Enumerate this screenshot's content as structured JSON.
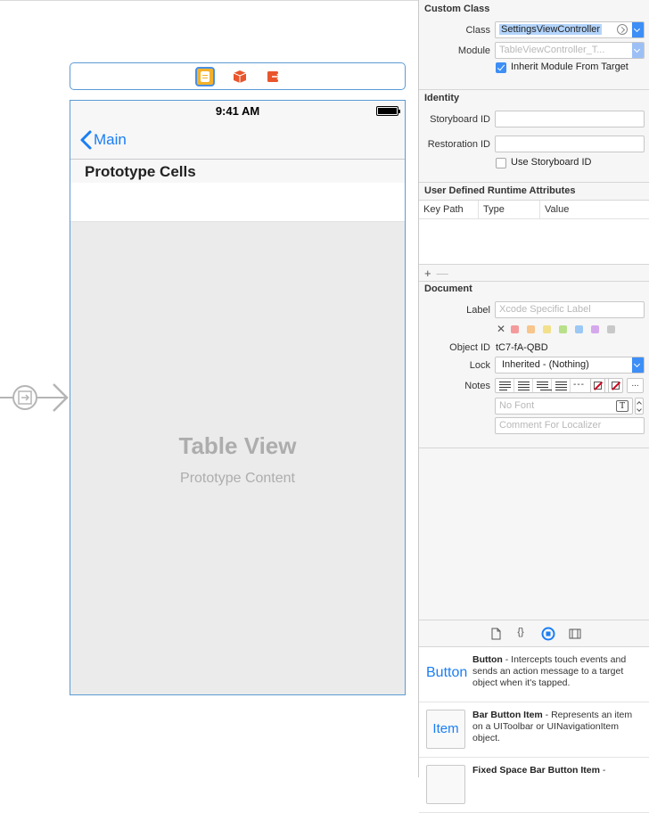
{
  "canvas": {
    "status_time": "9:41 AM",
    "back_label": "Main",
    "section_header": "Prototype Cells",
    "table_view_title": "Table View",
    "table_view_subtitle": "Prototype Content"
  },
  "inspector": {
    "custom_class": {
      "title": "Custom Class",
      "class_label": "Class",
      "class_value": "SettingsViewController",
      "module_label": "Module",
      "module_placeholder": "TableViewController_T...",
      "inherit_label": "Inherit Module From Target",
      "inherit_checked": true
    },
    "identity": {
      "title": "Identity",
      "storyboard_id_label": "Storyboard ID",
      "storyboard_id_value": "",
      "restoration_id_label": "Restoration ID",
      "restoration_id_value": "",
      "use_storyboard_id_label": "Use Storyboard ID",
      "use_storyboard_id_checked": false
    },
    "runtime_attributes": {
      "title": "User Defined Runtime Attributes",
      "columns": [
        "Key Path",
        "Type",
        "Value"
      ],
      "add_symbol": "+",
      "remove_symbol": "—"
    },
    "document": {
      "title": "Document",
      "label_label": "Label",
      "label_placeholder": "Xcode Specific Label",
      "clear_symbol": "✕",
      "label_colors": [
        "#f59a9a",
        "#f8c58a",
        "#f2e08a",
        "#b8e08a",
        "#9cc8f5",
        "#d5a8ec",
        "#c8c8c8"
      ],
      "object_id_label": "Object ID",
      "object_id_value": "tC7-fA-QBD",
      "lock_label": "Lock",
      "lock_value": "Inherited - (Nothing)",
      "notes_label": "Notes",
      "notes_dash": "---",
      "more_symbol": "...",
      "font_placeholder": "No Font",
      "font_icon": "T",
      "comment_placeholder": "Comment For Localizer"
    }
  },
  "library": {
    "tab_icons": [
      "file-icon",
      "braces-icon",
      "circle-target-icon",
      "film-icon"
    ],
    "tab_glyph_braces": "{}",
    "items": [
      {
        "thumb": "Button",
        "name": "Button",
        "description": " - Intercepts touch events and sends an action message to a target object when it's tapped."
      },
      {
        "thumb": "Item",
        "name": "Bar Button Item",
        "description": " - Represents an item on a UIToolbar or UINavigationItem object."
      },
      {
        "thumb": "",
        "name": "Fixed Space Bar Button Item",
        "description": " -"
      }
    ]
  },
  "colors": {
    "accent": "#1a7ef5",
    "selection": "#5b9bd5",
    "scene_icon": "#f4b12a"
  }
}
